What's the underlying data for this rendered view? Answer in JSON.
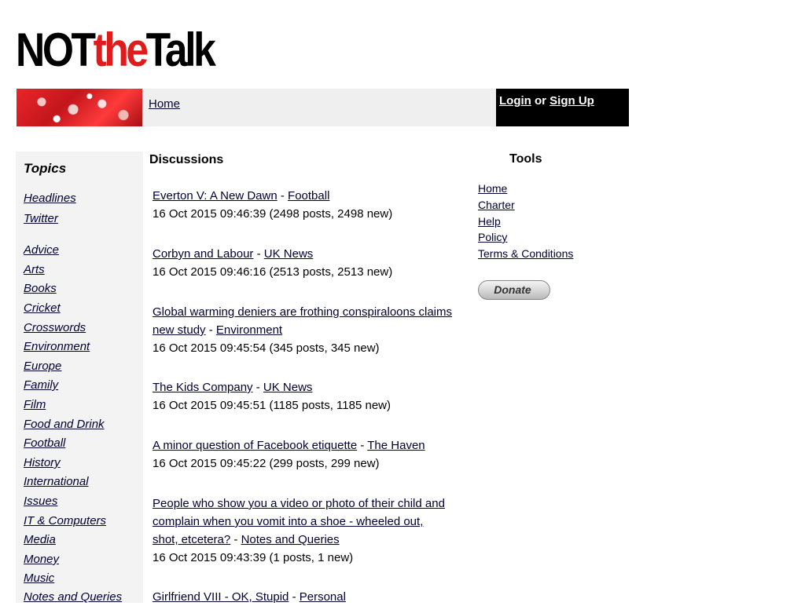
{
  "logo": {
    "part1": "NOT",
    "part2": "the",
    "part3": "Talk"
  },
  "colors": {
    "accent": "#e01b1b",
    "link": "#000033",
    "sidebar_bg": "#f3f3f3",
    "login_bg": "#000000"
  },
  "header": {
    "home_link": "Home",
    "login": {
      "login_label": "Login",
      "or_text": "or",
      "signup_label": "Sign Up"
    }
  },
  "sidebar": {
    "heading": "Topics",
    "pinned": [
      "Headlines",
      "Twitter"
    ],
    "topics": [
      "Advice",
      "Arts",
      "Books",
      "Cricket",
      "Crosswords",
      "Environment",
      "Europe",
      "Family",
      "Film",
      "Food and Drink",
      "Football",
      "History",
      "International",
      "Issues",
      "IT & Computers",
      "Media",
      "Money",
      "Music",
      "Notes and Queries"
    ]
  },
  "discussions": {
    "title": "Discussions",
    "threads": [
      {
        "title": "Everton V: A New Dawn",
        "sep": "-",
        "topic": "Football",
        "meta": "16 Oct 2015 09:46:39 (2498 posts, 2498 new)"
      },
      {
        "title": "Corbyn and Labour",
        "sep": "-",
        "topic": "UK News",
        "meta": "16 Oct 2015 09:46:16 (2513 posts, 2513 new)"
      },
      {
        "title": "Global warming deniers are frothing conspiraloons claims new study",
        "sep": "-",
        "topic": "Environment",
        "meta": "16 Oct 2015 09:45:54 (345 posts, 345 new)"
      },
      {
        "title": "The Kids Company",
        "sep": "-",
        "topic": "UK News",
        "meta": "16 Oct 2015 09:45:51 (1185 posts, 1185 new)"
      },
      {
        "title": "A minor question of Facebook etiquette",
        "sep": "-",
        "topic": "The Haven",
        "meta": "16 Oct 2015 09:45:22 (299 posts, 299 new)"
      },
      {
        "title": "People who show you a video or photo of their child and complain when you vomit into a shoe - wheeled out, shot, etcetera?",
        "sep": "-",
        "topic": "Notes and Queries",
        "meta": "16 Oct 2015 09:43:39 (1 posts, 1 new)"
      },
      {
        "title": "Girlfriend VIII - OK, Stupid",
        "sep": "-",
        "topic": "Personal",
        "meta": ""
      }
    ]
  },
  "tools": {
    "title": "Tools",
    "links": [
      "Home",
      "Charter",
      "Help",
      "Policy",
      "Terms & Conditions"
    ],
    "donate_label": "Donate"
  }
}
